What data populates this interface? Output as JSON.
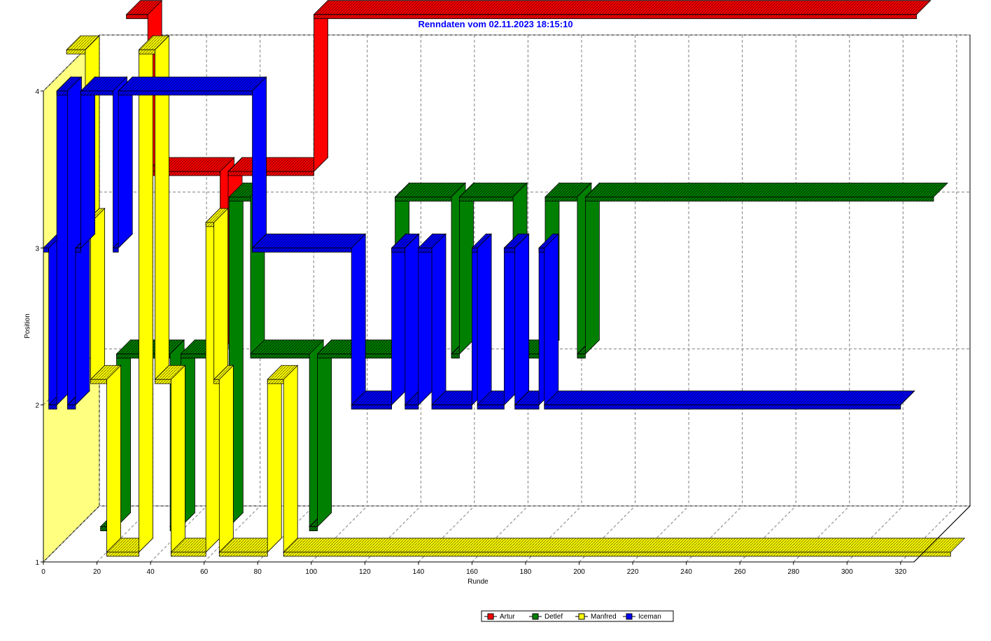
{
  "chart_data": {
    "type": "line",
    "title": "Renndaten vom 02.11.2023 18:15:10",
    "xlabel": "Runde",
    "ylabel": "Position",
    "xlim": [
      0,
      325
    ],
    "ylim": [
      1,
      4
    ],
    "xticks": [
      "0",
      "20",
      "40",
      "60",
      "80",
      "100",
      "120",
      "140",
      "160",
      "180",
      "200",
      "220",
      "240",
      "260",
      "280",
      "300",
      "320"
    ],
    "yticks": [
      "1",
      "2",
      "3",
      "4"
    ],
    "grid": true,
    "legend_position": "bottom-center",
    "series": [
      {
        "name": "Artur",
        "color": "#ff0000",
        "points": [
          [
            20,
            4.3
          ],
          [
            28,
            4.3
          ],
          [
            28,
            3.3
          ],
          [
            55,
            3.3
          ],
          [
            55,
            2.2
          ],
          [
            58,
            2.2
          ],
          [
            58,
            3.3
          ],
          [
            90,
            3.3
          ],
          [
            90,
            4.3
          ],
          [
            315,
            4.3
          ]
        ]
      },
      {
        "name": "Detlef",
        "color": "#008000",
        "points": [
          [
            14,
            1.1
          ],
          [
            20,
            1.1
          ],
          [
            20,
            2.2
          ],
          [
            40,
            2.2
          ],
          [
            40,
            1.1
          ],
          [
            44,
            1.1
          ],
          [
            44,
            2.2
          ],
          [
            55,
            2.2
          ],
          [
            55,
            1.1
          ],
          [
            62,
            1.1
          ],
          [
            62,
            3.2
          ],
          [
            70,
            3.2
          ],
          [
            70,
            2.2
          ],
          [
            92,
            2.2
          ],
          [
            92,
            1.1
          ],
          [
            95,
            1.1
          ],
          [
            95,
            2.2
          ],
          [
            124,
            2.2
          ],
          [
            124,
            3.2
          ],
          [
            145,
            3.2
          ],
          [
            145,
            2.2
          ],
          [
            148,
            2.2
          ],
          [
            148,
            3.2
          ],
          [
            168,
            3.2
          ],
          [
            168,
            2.2
          ],
          [
            180,
            2.2
          ],
          [
            180,
            3.2
          ],
          [
            192,
            3.2
          ],
          [
            192,
            2.2
          ],
          [
            195,
            2.2
          ],
          [
            195,
            3.2
          ],
          [
            325,
            3.2
          ]
        ]
      },
      {
        "name": "Manfred",
        "color": "#ffff00",
        "points": [
          [
            5,
            4.2
          ],
          [
            12,
            4.2
          ],
          [
            12,
            3.1
          ],
          [
            14,
            3.1
          ],
          [
            14,
            2.1
          ],
          [
            20,
            2.1
          ],
          [
            20,
            1.0
          ],
          [
            32,
            1.0
          ],
          [
            32,
            4.2
          ],
          [
            38,
            4.2
          ],
          [
            38,
            2.1
          ],
          [
            44,
            2.1
          ],
          [
            44,
            1.0
          ],
          [
            57,
            1.0
          ],
          [
            57,
            3.1
          ],
          [
            60,
            3.1
          ],
          [
            60,
            2.1
          ],
          [
            62,
            2.1
          ],
          [
            62,
            1.0
          ],
          [
            80,
            1.0
          ],
          [
            80,
            2.1
          ],
          [
            86,
            2.1
          ],
          [
            86,
            1.0
          ],
          [
            335,
            1.0
          ]
        ]
      },
      {
        "name": "Iceman",
        "color": "#0000ff",
        "points": [
          [
            0,
            3.0
          ],
          [
            2,
            3.0
          ],
          [
            2,
            2.0
          ],
          [
            5,
            2.0
          ],
          [
            5,
            4.0
          ],
          [
            9,
            4.0
          ],
          [
            9,
            2.0
          ],
          [
            12,
            2.0
          ],
          [
            12,
            3.0
          ],
          [
            14,
            3.0
          ],
          [
            14,
            4.0
          ],
          [
            26,
            4.0
          ],
          [
            26,
            3.0
          ],
          [
            28,
            3.0
          ],
          [
            28,
            4.0
          ],
          [
            78,
            4.0
          ],
          [
            78,
            3.0
          ],
          [
            115,
            3.0
          ],
          [
            115,
            2.0
          ],
          [
            130,
            2.0
          ],
          [
            130,
            3.0
          ],
          [
            135,
            3.0
          ],
          [
            135,
            2.0
          ],
          [
            140,
            2.0
          ],
          [
            140,
            3.0
          ],
          [
            145,
            3.0
          ],
          [
            145,
            2.0
          ],
          [
            160,
            2.0
          ],
          [
            160,
            3.0
          ],
          [
            162,
            3.0
          ],
          [
            162,
            2.0
          ],
          [
            172,
            2.0
          ],
          [
            172,
            3.0
          ],
          [
            176,
            3.0
          ],
          [
            176,
            2.0
          ],
          [
            185,
            2.0
          ],
          [
            185,
            3.0
          ],
          [
            187,
            3.0
          ],
          [
            187,
            2.0
          ],
          [
            320,
            2.0
          ]
        ]
      }
    ]
  }
}
